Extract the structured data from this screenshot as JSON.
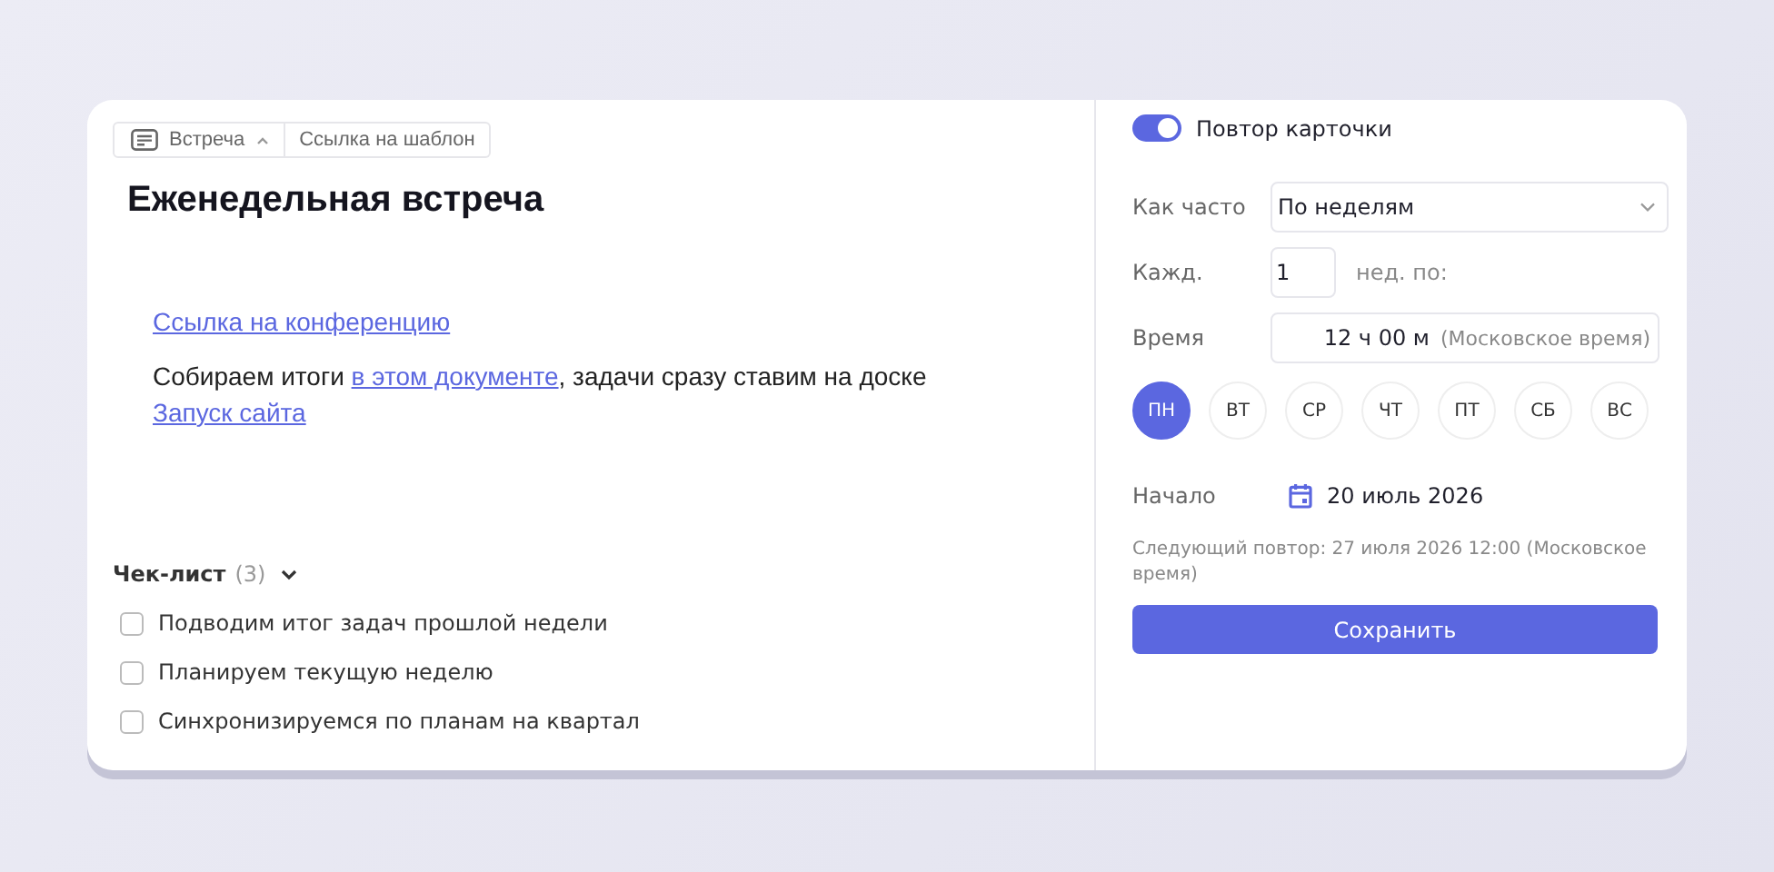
{
  "toolbar": {
    "type_button": "Встреча",
    "template_link": "Ссылка на шаблон"
  },
  "title": "Еженедельная встреча",
  "description": {
    "conference_link": "Ссылка на конференцию",
    "paragraph": [
      {
        "kind": "text",
        "text": "Собираем итоги "
      },
      {
        "kind": "link",
        "text": "в этом документе"
      },
      {
        "kind": "text",
        "text": ", задачи сразу ставим на доске "
      },
      {
        "kind": "link",
        "text": "Запуск сайта"
      }
    ]
  },
  "checklist": {
    "title": "Чек-лист",
    "count": "(3)",
    "expanded": true,
    "items": [
      {
        "label": "Подводим итог задач прошлой недели",
        "checked": false
      },
      {
        "label": "Планируем текущую неделю",
        "checked": false
      },
      {
        "label": "Синхронизируемся по планам на квартал",
        "checked": false
      }
    ]
  },
  "repeat": {
    "toggle": {
      "label": "Повтор карточки",
      "on": true
    },
    "frequency": {
      "label": "Как часто",
      "value": "По неделям"
    },
    "every": {
      "label": "Кажд.",
      "value": "1",
      "unit": "нед. по:"
    },
    "time": {
      "label": "Время",
      "value": "12 ч 00 м",
      "zone": "(Московское время)"
    },
    "days": [
      {
        "label": "ПН",
        "selected": true
      },
      {
        "label": "ВТ",
        "selected": false
      },
      {
        "label": "СР",
        "selected": false
      },
      {
        "label": "ЧТ",
        "selected": false
      },
      {
        "label": "ПТ",
        "selected": false
      },
      {
        "label": "СБ",
        "selected": false
      },
      {
        "label": "ВС",
        "selected": false
      }
    ],
    "start": {
      "label": "Начало",
      "value": "20 июль 2026"
    },
    "next": "Следующий повтор: 27 июля 2026 12:00 (Московское время)",
    "save_button": "Сохранить"
  }
}
